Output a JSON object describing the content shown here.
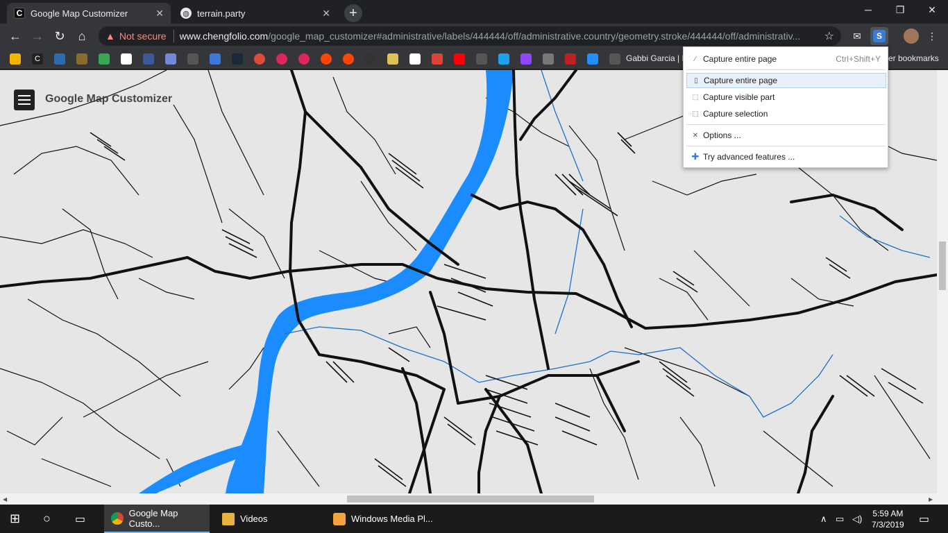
{
  "tabs": [
    {
      "title": "Google Map Customizer",
      "favicon": "C",
      "active": true
    },
    {
      "title": "terrain.party",
      "favicon": "globe-icon",
      "active": false
    }
  ],
  "omnibox": {
    "security": "Not secure",
    "url_host": "www.chengfolio.com",
    "url_path": "/google_map_customizer#administrative/labels/444444/off/administrative.country/geometry.stroke/444444/off/administrativ..."
  },
  "bookmarks": {
    "partial_label": "Gabbi Garcia | M",
    "other": "er bookmarks"
  },
  "app": {
    "title": "Google Map Customizer"
  },
  "menu": {
    "items": [
      {
        "label": "Capture entire page",
        "shortcut": "Ctrl+Shift+Y",
        "icon": "pen-icon"
      },
      {
        "label": "Capture entire page",
        "shortcut": "",
        "icon": "page-icon"
      },
      {
        "label": "Capture visible part",
        "shortcut": "",
        "icon": "visible-part-icon"
      },
      {
        "label": "Capture selection",
        "shortcut": "",
        "icon": "selection-icon"
      },
      {
        "label": "Options ...",
        "shortcut": "",
        "icon": "tools-icon"
      },
      {
        "label": "Try advanced features ...",
        "shortcut": "",
        "icon": "plus-icon"
      }
    ]
  },
  "taskbar": {
    "apps": [
      {
        "label": "Google Map Custo..."
      },
      {
        "label": "Videos"
      },
      {
        "label": "Windows Media Pl..."
      }
    ],
    "time": "5:59 AM",
    "date": "7/3/2019"
  },
  "colors": {
    "river": "#1a8cff",
    "map_bg": "#e6e6e6",
    "roads": "#111111",
    "menu_highlight": "#e8f0fb"
  }
}
